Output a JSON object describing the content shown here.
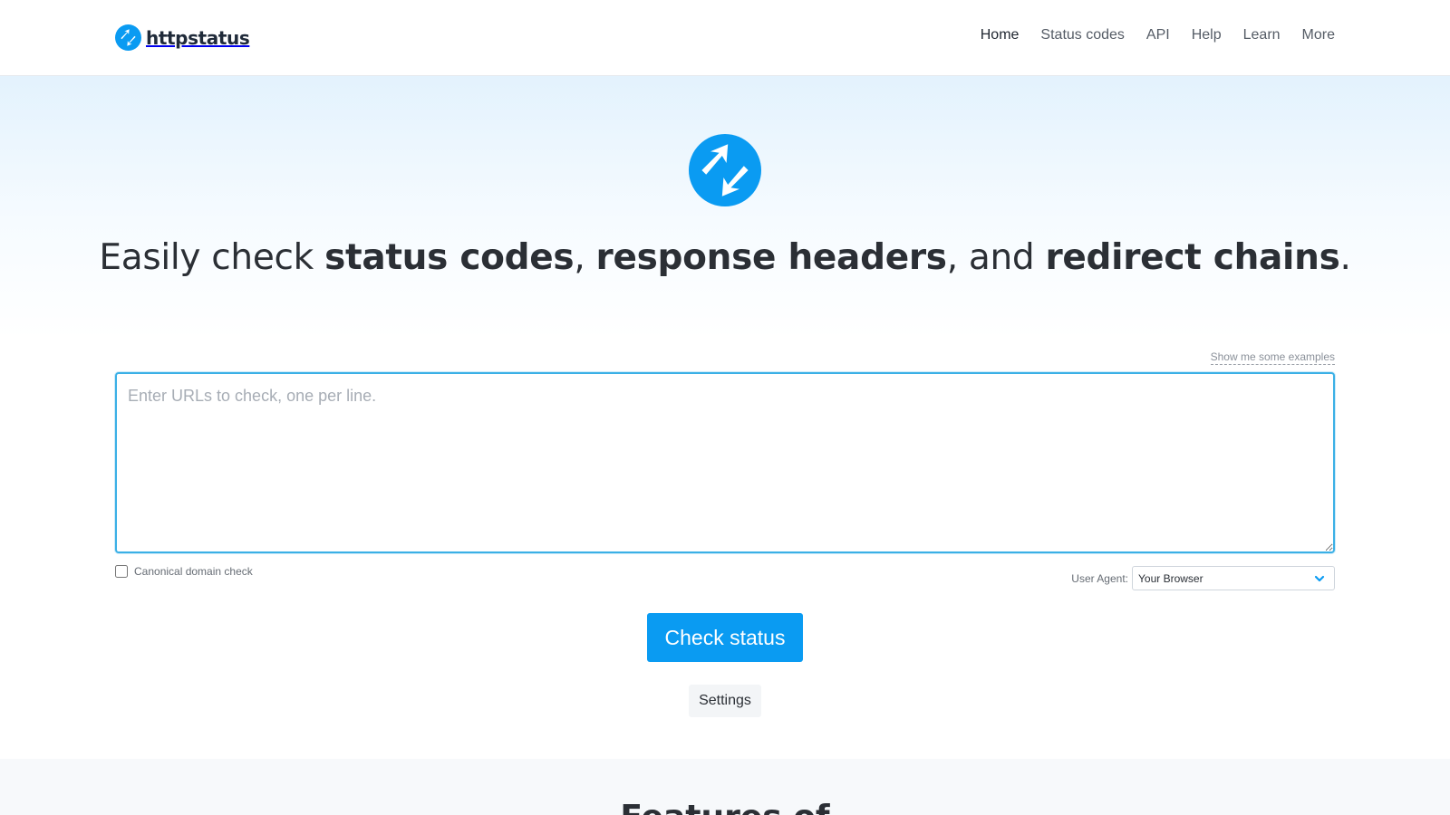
{
  "brand": {
    "name": "httpstatus",
    "accent_color": "#0a9bf2",
    "logo_icon": "redirect-arrows-icon"
  },
  "nav": {
    "items": [
      {
        "label": "Home",
        "active": true
      },
      {
        "label": "Status codes",
        "active": false
      },
      {
        "label": "API",
        "active": false
      },
      {
        "label": "Help",
        "active": false
      },
      {
        "label": "Learn",
        "active": false
      },
      {
        "label": "More",
        "active": false
      }
    ]
  },
  "hero": {
    "title_parts": {
      "t1": "Easily check ",
      "b1": "status codes",
      "t2": ", ",
      "b2": "response headers",
      "t3": ", and ",
      "b3": "redirect chains",
      "t4": "."
    },
    "examples_link": "Show me some examples"
  },
  "form": {
    "url_placeholder": "Enter URLs to check, one per line.",
    "url_value": "",
    "canonical_label": "Canonical domain check",
    "canonical_checked": false,
    "user_agent_label": "User Agent:",
    "user_agent_value": "Your Browser",
    "check_button": "Check status",
    "settings_button": "Settings"
  },
  "lower": {
    "heading": "Features of"
  }
}
